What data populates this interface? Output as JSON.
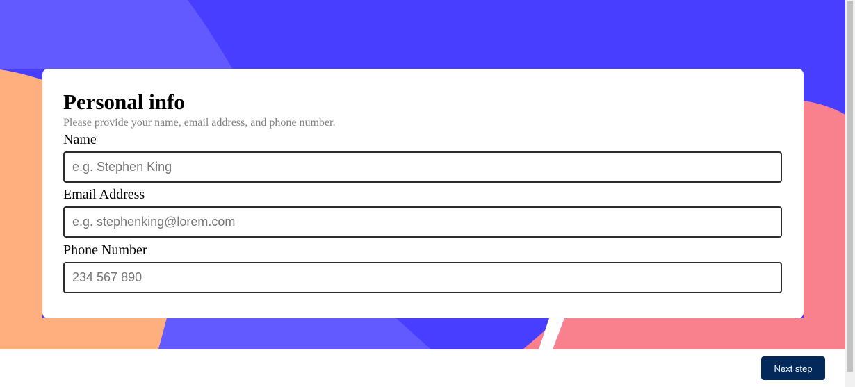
{
  "form": {
    "title": "Personal info",
    "subtitle": "Please provide your name, email address, and phone number.",
    "fields": [
      {
        "label": "Name",
        "placeholder": "e.g. Stephen King",
        "value": ""
      },
      {
        "label": "Email Address",
        "placeholder": "e.g. stephenking@lorem.com",
        "value": ""
      },
      {
        "label": "Phone Number",
        "placeholder": "234 567 890",
        "value": ""
      }
    ]
  },
  "footer": {
    "next_label": "Next step"
  },
  "colors": {
    "background_blue": "#483eff",
    "light_blue": "#6259ff",
    "orange": "#ffaf7e",
    "pink": "#f9818e",
    "button": "#02295a"
  }
}
